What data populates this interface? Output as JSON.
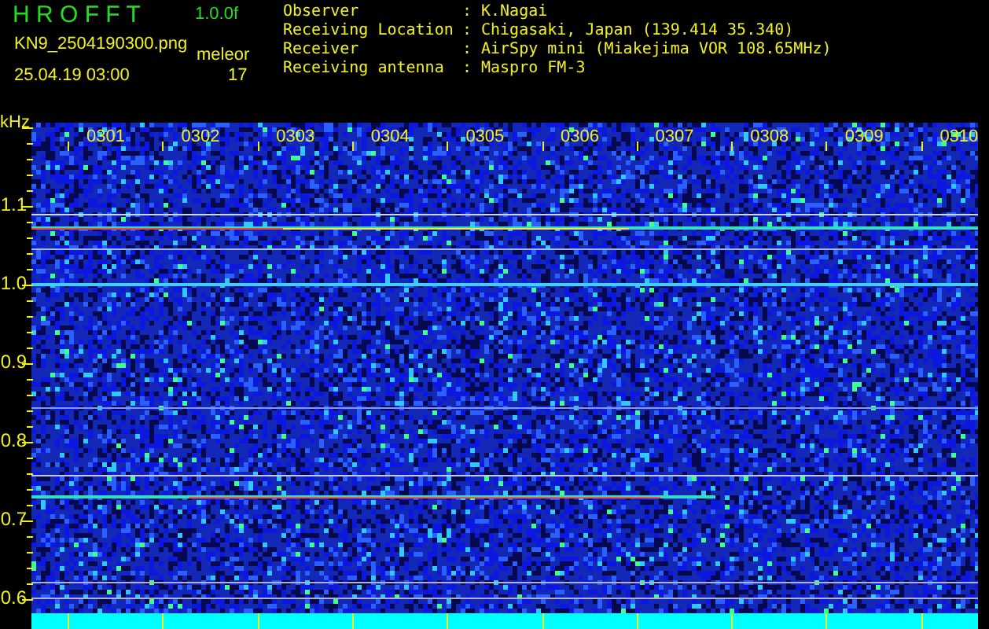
{
  "header": {
    "title": "H R O F F T",
    "version": "1.0.0f",
    "filename": "KN9_2504190300.png",
    "datetime": "25.04.19 03:00",
    "detection_label": "meleor",
    "count": "17"
  },
  "station_info": [
    {
      "label": "Observer",
      "separator": ":",
      "value": "K.Nagai"
    },
    {
      "label": "Receiving Location",
      "separator": ":",
      "value": "Chigasaki, Japan (139.414 35.340)"
    },
    {
      "label": "Receiver",
      "separator": ":",
      "value": "AirSpy mini (Miakejima VOR 108.65MHz)"
    },
    {
      "label": "Receiving antenna",
      "separator": ":",
      "value": "Maspro FM-3"
    }
  ],
  "spectrogram": {
    "unit": "kHz",
    "y_labels": [
      "1.1",
      "1.0",
      "0.9",
      "0.8",
      "0.7",
      "0.6"
    ],
    "x_labels": [
      "0301",
      "0302",
      "0303",
      "0304",
      "0305",
      "0306",
      "0307",
      "0308",
      "0309",
      "0310"
    ]
  }
}
